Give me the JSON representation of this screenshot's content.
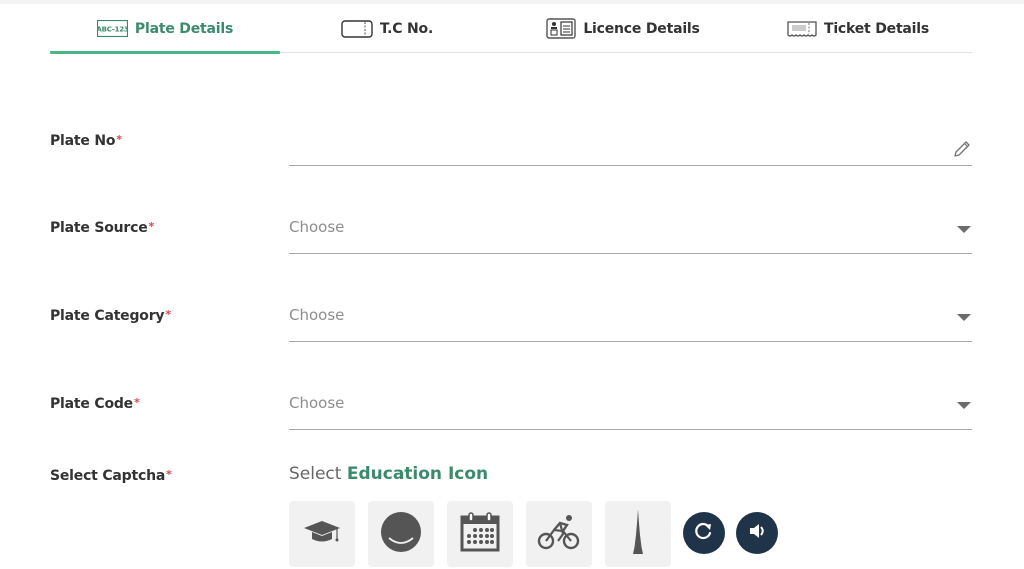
{
  "tabs": [
    {
      "label": "Plate Details",
      "icon": "plate-number-icon",
      "icon_text": "ABC-123",
      "active": true
    },
    {
      "label": "T.C No.",
      "icon": "ticket-card-icon",
      "active": false
    },
    {
      "label": "Licence Details",
      "icon": "id-card-icon",
      "active": false
    },
    {
      "label": "Ticket Details",
      "icon": "receipt-icon",
      "active": false
    }
  ],
  "form": {
    "plate_no": {
      "label": "Plate No",
      "required_mark": "*",
      "value": "",
      "icon": "pencil-icon"
    },
    "plate_source": {
      "label": "Plate Source",
      "required_mark": "*",
      "placeholder": "Choose"
    },
    "plate_category": {
      "label": "Plate Category",
      "required_mark": "*",
      "placeholder": "Choose"
    },
    "plate_code": {
      "label": "Plate Code",
      "required_mark": "*",
      "placeholder": "Choose"
    }
  },
  "captcha": {
    "label": "Select Captcha",
    "required_mark": "*",
    "prompt_prefix": "Select",
    "prompt_keyword": "Education Icon",
    "options": [
      {
        "icon": "graduation-cap-icon"
      },
      {
        "icon": "smiley-icon"
      },
      {
        "icon": "calendar-icon"
      },
      {
        "icon": "cyclist-icon"
      },
      {
        "icon": "tower-icon"
      }
    ],
    "refresh_icon": "refresh-icon",
    "audio_icon": "speaker-icon"
  },
  "colors": {
    "accent": "#3a8a6c",
    "tab_indicator": "#47b883",
    "required": "#e0444f",
    "circle_button": "#1f3448"
  }
}
